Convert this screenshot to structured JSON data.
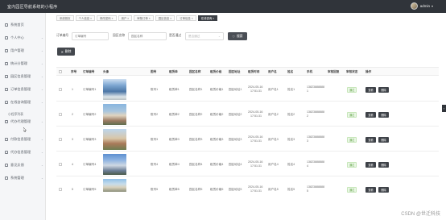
{
  "header": {
    "title": "室内园区导航系统的小程序",
    "user_name": "admin",
    "user_caret": "▾"
  },
  "sidebar": {
    "items": [
      {
        "label": "系统首页",
        "has_chevron": false
      },
      {
        "label": "个人中心",
        "has_chevron": true
      },
      {
        "label": "用户管理",
        "has_chevron": true
      },
      {
        "label": "统计分管理",
        "has_chevron": true
      },
      {
        "label": "园区信息管理",
        "has_chevron": true
      },
      {
        "label": "订单信息管理",
        "has_chevron": true
      },
      {
        "label": "在线咨询管理",
        "has_chevron": true
      },
      {
        "label": "代办代理管理",
        "has_chevron": true
      },
      {
        "label": "付款信息管理",
        "has_chevron": true
      },
      {
        "label": "代办信息管理",
        "has_chevron": true
      },
      {
        "label": "意见反馈",
        "has_chevron": true
      },
      {
        "label": "系统管理",
        "has_chevron": true
      }
    ],
    "sub_label": "小程序列表",
    "chevron": "⌄"
  },
  "breadcrumbs": [
    {
      "label": "系统首页",
      "active": false
    },
    {
      "label": "个人信息 ×",
      "active": false
    },
    {
      "label": "修改密码 ×",
      "active": false
    },
    {
      "label": "用户 ×",
      "active": false
    },
    {
      "label": "审核订单 ×",
      "active": false
    },
    {
      "label": "园区信息 ×",
      "active": false
    },
    {
      "label": "订单信息 ×",
      "active": false
    },
    {
      "label": "在线咨询 ×",
      "active": true
    }
  ],
  "search": {
    "field1_label": "订单编号",
    "field1_placeholder": "订单编号",
    "field2_label": "园区名称",
    "field2_placeholder": "园区名称",
    "field3_label": "是否通过",
    "field3_placeholder": "是否通过",
    "button_label": "搜索",
    "button_icon": "search-icon"
  },
  "actions": {
    "delete_label": "删除",
    "delete_icon": "close-icon"
  },
  "table": {
    "headers": [
      "序号",
      "订单编号",
      "头像",
      "图号",
      "租赁单",
      "园区名称",
      "租赁价格",
      "园区地址",
      "租赁时间",
      "用户名",
      "姓名",
      "手机",
      "审核回复",
      "审核状态",
      "操作"
    ],
    "rows": [
      {
        "index": "1",
        "order_no": "订单编号1",
        "num": "账号1",
        "rent": "租赁单1",
        "park": "园区名称1",
        "price": "租赁价格1",
        "address": "园区地址1",
        "date1": "2024-05-16",
        "date2": "17:51:31",
        "user": "用户名1",
        "name": "姓名1",
        "phone1": "13823888888",
        "phone2": "1",
        "status": "通过"
      },
      {
        "index": "2",
        "order_no": "订单编号2",
        "num": "账号2",
        "rent": "租赁单2",
        "park": "园区名称2",
        "price": "租赁价格2",
        "address": "园区地址2",
        "date1": "2024-05-16",
        "date2": "17:51:31",
        "user": "用户名2",
        "name": "姓名2",
        "phone1": "13823888888",
        "phone2": "2",
        "status": "通过"
      },
      {
        "index": "3",
        "order_no": "订单编号3",
        "num": "账号3",
        "rent": "租赁单3",
        "park": "园区名称3",
        "price": "租赁价格3",
        "address": "园区地址3",
        "date1": "2024-05-16",
        "date2": "17:51:31",
        "user": "用户名3",
        "name": "姓名3",
        "phone1": "13823888888",
        "phone2": "3",
        "status": "通过"
      },
      {
        "index": "4",
        "order_no": "订单编号4",
        "num": "账号4",
        "rent": "租赁单4",
        "park": "园区名称4",
        "price": "租赁价格4",
        "address": "园区地址4",
        "date1": "2024-05-16",
        "date2": "17:51:31",
        "user": "用户名4",
        "name": "姓名4",
        "phone1": "13823888888",
        "phone2": "4",
        "status": "通过"
      },
      {
        "index": "5",
        "order_no": "订单编号5",
        "num": "账号5",
        "rent": "租赁单5",
        "park": "园区名称5",
        "price": "租赁价格5",
        "address": "园区地址5",
        "date1": "2024-05-16",
        "date2": "17:51:31",
        "user": "用户名5",
        "name": "姓名5",
        "phone1": "13823888888",
        "phone2": "5",
        "status": "通过"
      }
    ],
    "op_view": "查看",
    "op_delete": "删除"
  },
  "misc": {
    "toggle_glyph": "›",
    "watermark": "CSDN @世迁科技"
  }
}
